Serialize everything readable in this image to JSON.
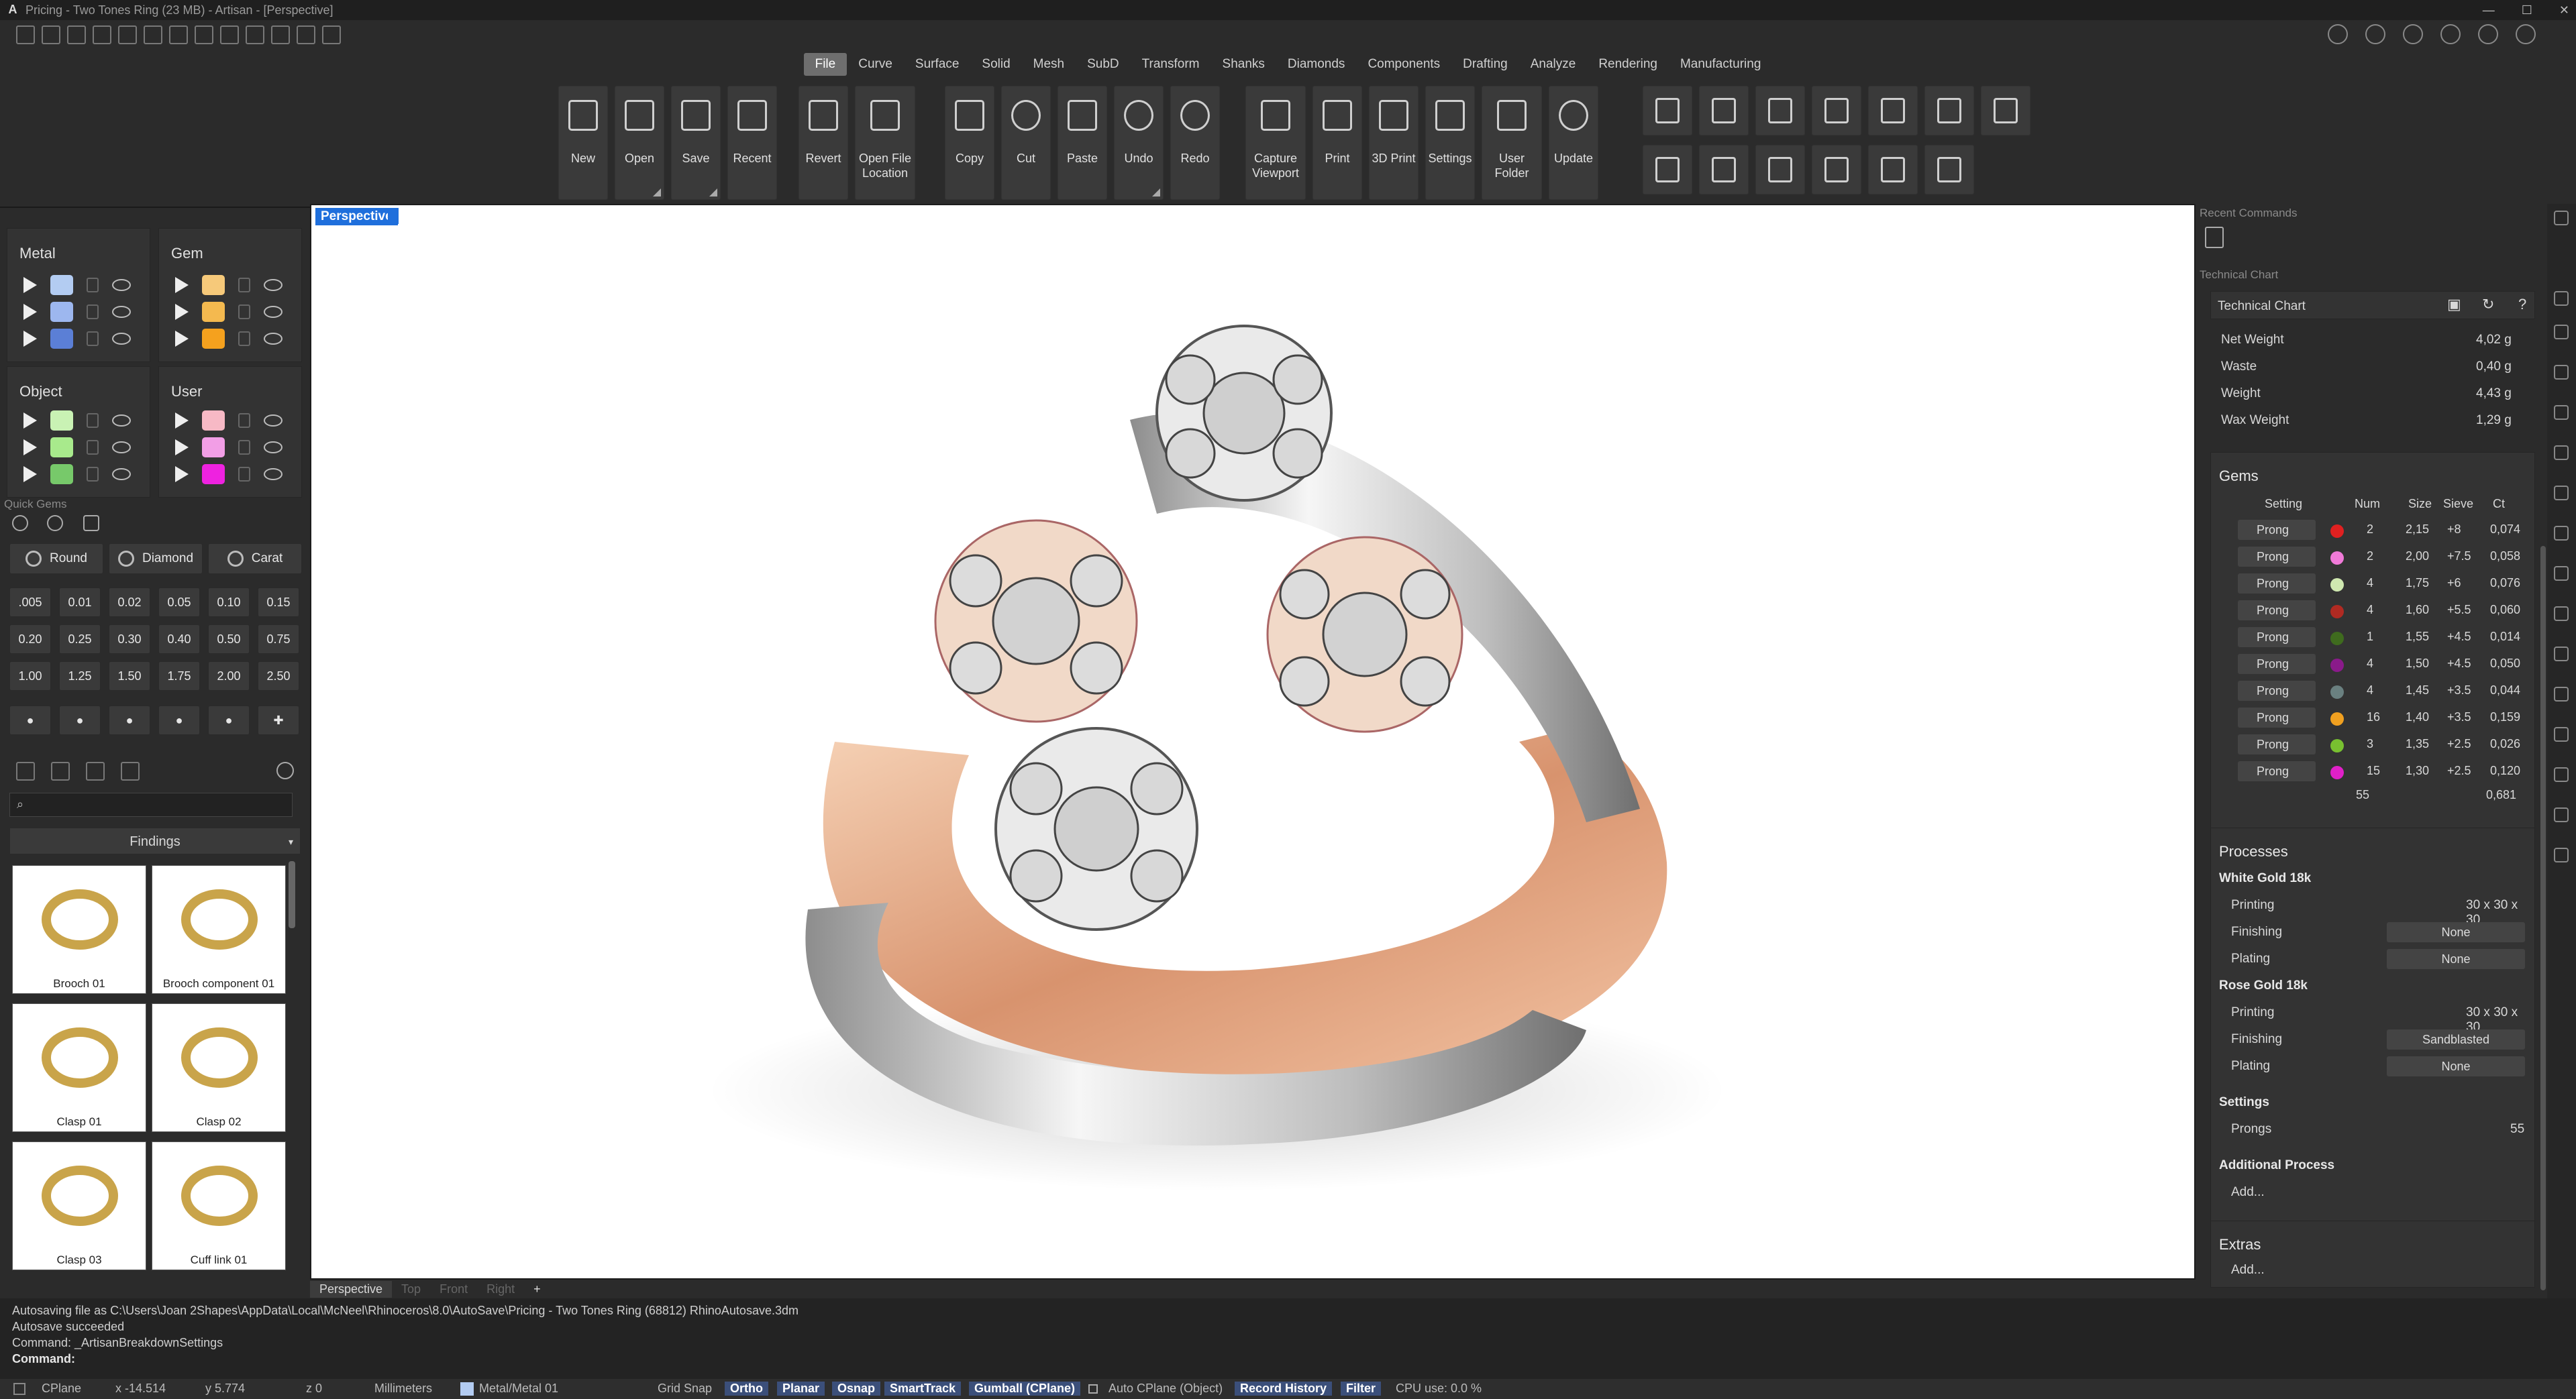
{
  "window": {
    "title": "Pricing - Two Tones Ring (23 MB) - Artisan - [Perspective]"
  },
  "menu": {
    "tabs": [
      "File",
      "Curve",
      "Surface",
      "Solid",
      "Mesh",
      "SubD",
      "Transform",
      "Shanks",
      "Diamonds",
      "Components",
      "Drafting",
      "Analyze",
      "Rendering",
      "Manufacturing"
    ],
    "active": "File"
  },
  "toolbar": {
    "new": "New",
    "open": "Open",
    "save": "Save",
    "recent": "Recent",
    "revert": "Revert",
    "open_file_location": "Open File Location",
    "copy": "Copy",
    "cut": "Cut",
    "paste": "Paste",
    "undo": "Undo",
    "redo": "Redo",
    "capture_viewport": "Capture Viewport",
    "print": "Print",
    "print3d": "3D Print",
    "settings": "Settings",
    "user_folder": "User Folder",
    "update": "Update"
  },
  "layers": {
    "metal": {
      "title": "Metal",
      "colors": [
        "#b3ccf2",
        "#9db7ef",
        "#5b7fd6"
      ]
    },
    "gem": {
      "title": "Gem",
      "colors": [
        "#f6c97a",
        "#f4b94f",
        "#f5a11e"
      ]
    },
    "object": {
      "title": "Object",
      "colors": [
        "#c9f2b4",
        "#a8ea8c",
        "#77c96a"
      ]
    },
    "user": {
      "title": "User",
      "colors": [
        "#f7b9c5",
        "#f29ee6",
        "#ee22e0"
      ]
    }
  },
  "quick_gems": {
    "title": "Quick Gems",
    "shape": "Round",
    "material": "Diamond",
    "unit": "Carat",
    "sizes": [
      ".005",
      "0.01",
      "0.02",
      "0.05",
      "0.10",
      "0.15",
      "0.20",
      "0.25",
      "0.30",
      "0.40",
      "0.50",
      "0.75",
      "1.00",
      "1.25",
      "1.50",
      "1.75",
      "2.00",
      "2.50"
    ]
  },
  "findings": {
    "category": "Findings",
    "search_placeholder": "",
    "items": [
      "Brooch 01",
      "Brooch component 01",
      "Clasp 01",
      "Clasp 02",
      "Clasp 03",
      "Cuff link 01"
    ]
  },
  "viewport": {
    "label": "Perspective",
    "tabs": [
      "Perspective",
      "Top",
      "Front",
      "Right"
    ]
  },
  "right": {
    "recent_commands": "Recent Commands",
    "technical_chart_header": "Technical Chart",
    "technical_chart_title": "Technical Chart",
    "weights": [
      {
        "k": "Net Weight",
        "v": "4,02 g"
      },
      {
        "k": "Waste",
        "v": "0,40 g"
      },
      {
        "k": "Weight",
        "v": "4,43 g"
      },
      {
        "k": "Wax Weight",
        "v": "1,29 g"
      }
    ],
    "gems": {
      "title": "Gems",
      "headers": {
        "setting": "Setting",
        "num": "Num",
        "size": "Size",
        "sieve": "Sieve",
        "ct": "Ct"
      },
      "rows": [
        {
          "setting": "Prong",
          "color": "#e02020",
          "num": "2",
          "size": "2,15",
          "sieve": "+8",
          "ct": "0,074"
        },
        {
          "setting": "Prong",
          "color": "#f07ad8",
          "num": "2",
          "size": "2,00",
          "sieve": "+7.5",
          "ct": "0,058"
        },
        {
          "setting": "Prong",
          "color": "#cfe8b0",
          "num": "4",
          "size": "1,75",
          "sieve": "+6",
          "ct": "0,076"
        },
        {
          "setting": "Prong",
          "color": "#b02a22",
          "num": "4",
          "size": "1,60",
          "sieve": "+5.5",
          "ct": "0,060"
        },
        {
          "setting": "Prong",
          "color": "#3f6b1e",
          "num": "1",
          "size": "1,55",
          "sieve": "+4.5",
          "ct": "0,014"
        },
        {
          "setting": "Prong",
          "color": "#8a1a8a",
          "num": "4",
          "size": "1,50",
          "sieve": "+4.5",
          "ct": "0,050"
        },
        {
          "setting": "Prong",
          "color": "#6a8080",
          "num": "4",
          "size": "1,45",
          "sieve": "+3.5",
          "ct": "0,044"
        },
        {
          "setting": "Prong",
          "color": "#f0a020",
          "num": "16",
          "size": "1,40",
          "sieve": "+3.5",
          "ct": "0,159"
        },
        {
          "setting": "Prong",
          "color": "#78c030",
          "num": "3",
          "size": "1,35",
          "sieve": "+2.5",
          "ct": "0,026"
        },
        {
          "setting": "Prong",
          "color": "#e020c8",
          "num": "15",
          "size": "1,30",
          "sieve": "+2.5",
          "ct": "0,120"
        }
      ],
      "total_num": "55",
      "total_ct": "0,681"
    },
    "processes": {
      "title": "Processes",
      "white_gold": "White Gold 18k",
      "rose_gold": "Rose Gold 18k",
      "printing_label": "Printing",
      "finishing_label": "Finishing",
      "plating_label": "Plating",
      "wg_printing": "30 x 30 x 30",
      "wg_finishing": "None",
      "wg_plating": "None",
      "rg_printing": "30 x 30 x 30",
      "rg_finishing": "Sandblasted",
      "rg_plating": "None",
      "settings_title": "Settings",
      "prongs_label": "Prongs",
      "prongs_value": "55",
      "additional_title": "Additional Process",
      "add": "Add..."
    },
    "extras": {
      "title": "Extras",
      "add": "Add..."
    }
  },
  "command": {
    "history": [
      "Autosaving file as C:\\Users\\Joan 2Shapes\\AppData\\Local\\McNeel\\Rhinoceros\\8.0\\AutoSave\\Pricing - Two Tones Ring (68812) RhinoAutosave.3dm",
      "Autosave succeeded",
      "Command: _ArtisanBreakdownSettings"
    ],
    "prompt": "Command:"
  },
  "status": {
    "cplane": "CPlane",
    "x": "x -14.514",
    "y": "y 5.774",
    "z": "z 0",
    "units": "Millimeters",
    "layer": "Metal/Metal 01",
    "grid_snap": "Grid Snap",
    "ortho": "Ortho",
    "planar": "Planar",
    "osnap": "Osnap",
    "smarttrack": "SmartTrack",
    "gumball": "Gumball (CPlane)",
    "auto_cplane": "Auto CPlane (Object)",
    "record_history": "Record History",
    "filter": "Filter",
    "cpu": "CPU use: 0.0 %"
  }
}
